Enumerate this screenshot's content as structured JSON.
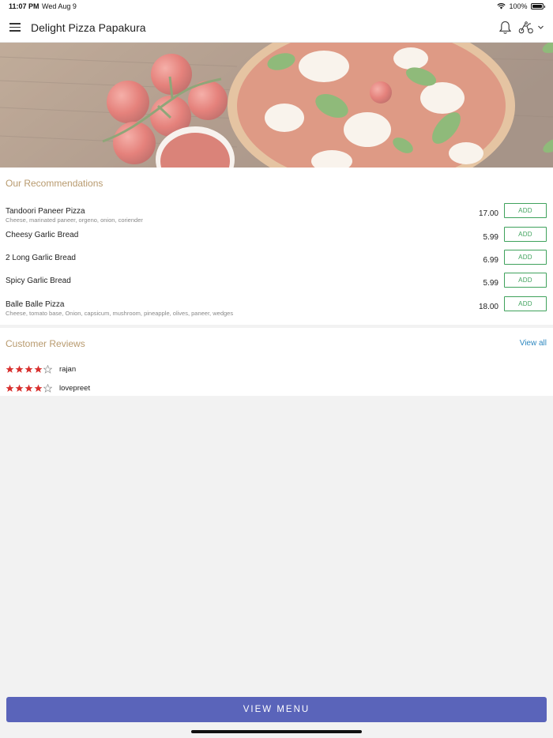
{
  "status_bar": {
    "time": "11:07 PM",
    "date": "Wed Aug 9",
    "battery": "100%"
  },
  "nav": {
    "title": "Delight Pizza Papakura"
  },
  "recommendations": {
    "title": "Our Recommendations",
    "add_label": "ADD",
    "items": [
      {
        "name": "Tandoori Paneer Pizza",
        "desc": "Cheese, marinated paneer, orgeno, onion, coriender",
        "price": "17.00"
      },
      {
        "name": "Cheesy Garlic Bread",
        "desc": "",
        "price": "5.99"
      },
      {
        "name": "2 Long Garlic Bread",
        "desc": "",
        "price": "6.99"
      },
      {
        "name": "Spicy Garlic Bread",
        "desc": "",
        "price": "5.99"
      },
      {
        "name": "Balle Balle Pizza",
        "desc": "Cheese, tomato base, Onion, capsicum, mushroom, pineapple, olives, paneer, wedges",
        "price": "18.00"
      }
    ]
  },
  "reviews": {
    "title": "Customer Reviews",
    "view_all": "View all",
    "items": [
      {
        "name": "rajan",
        "rating": 4
      },
      {
        "name": "lovepreet",
        "rating": 4
      }
    ]
  },
  "bottom": {
    "view_menu": "VIEW MENU"
  },
  "colors": {
    "accent": "#5a64ba",
    "add_green": "#3fa25c",
    "star_red": "#d8302e",
    "section_title": "#b89a6e",
    "link_blue": "#2e88c0"
  }
}
